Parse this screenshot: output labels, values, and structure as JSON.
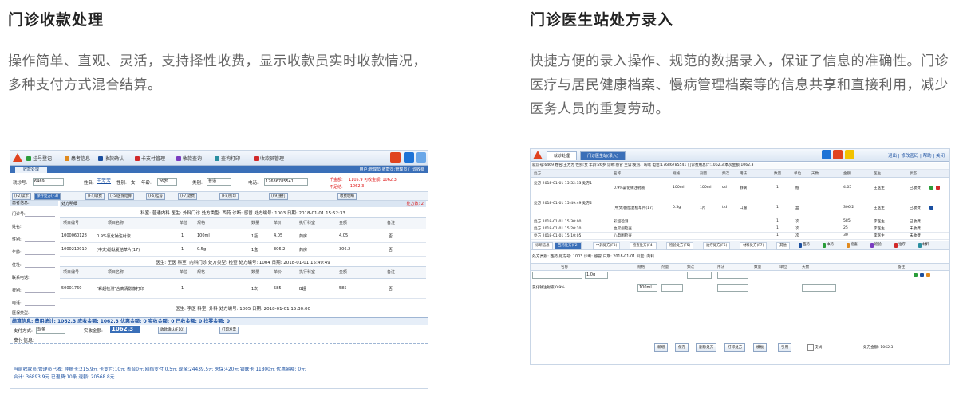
{
  "left": {
    "title": "门诊收款处理",
    "desc": "操作简单、直观、灵活，支持择性收费，显示收款员实时收款情况，多种支付方式混合结算。",
    "shot": {
      "toolbar": [
        "挂号登记",
        "患者信息",
        "收款确认",
        "卡支付管理",
        "收款查询",
        "查询打印",
        "收款员管理"
      ],
      "tab": "收款处理",
      "user_info": "用户:管理员 收款员:管理员 门诊收费",
      "form": {
        "card_label": "就诊号:",
        "card_value": "6469",
        "name_label": "姓名:",
        "name_value": "王芳芳",
        "sex_label": "性别:",
        "sex_value": "女",
        "age_label": "年龄:",
        "age_value": "26岁",
        "type_label": "类别:",
        "type_value": "普通",
        "phone_label": "电话:",
        "phone_value": "17686785541",
        "pay_label": "不足结:",
        "pay_value": "-1062.3",
        "due_label": "千金额:",
        "due_value": "1105.9 可收金额: 1062.3"
      },
      "buttons": [
        "(F2)读卡",
        "保存处方(F3)",
        "(F4)收费",
        "(F5)医保结算",
        "(F6)挂号",
        "(F7)退费",
        "(F8)打印",
        "(F9)重打",
        "收费明细"
      ],
      "side_head": "患者信息:",
      "side_rows": [
        "门诊号:",
        "姓名:",
        "性别:",
        "年龄:",
        "住址:",
        "联系电话:",
        "费别:",
        "电话:",
        "医保类型:"
      ],
      "main_head": "处方明细",
      "rx_total": "处方数: 2",
      "rx1_info": "科室: 普通内科 医生: 外科门诊 处方类型: 西药 诊断: 感冒 处方编号: 1003 日期: 2018-01-01 15:52:33",
      "grid_cols": [
        "项目编号",
        "项目名称",
        "单位",
        "规格",
        "数量",
        "单价",
        "执行科室",
        "金额",
        "备注"
      ],
      "rows1": [
        {
          "code": "1000060128",
          "name": "0.9%氯化钠注射液",
          "unit": "1",
          "spec": "100ml",
          "qty": "1瓶",
          "price": "4.05",
          "dept": "药房",
          "amt": "4.05",
          "note": "否"
        },
        {
          "code": "1000210010",
          "name": "(中文)酚酞夏枯草片(17)",
          "unit": "1",
          "spec": "0.5g",
          "qty": "1盒",
          "price": "306.2",
          "dept": "药房",
          "amt": "306.2",
          "note": "否"
        }
      ],
      "rx2_info": "医生: 王医 科室: 内科门诊 处方类型: 检查 处方编号: 1004 日期: 2018-01-01 15:49:49",
      "rows2": [
        {
          "code": "50001760",
          "name": "\"彩超检测\"含高清影像打印",
          "unit": "1",
          "spec": "",
          "qty": "1次",
          "price": "585",
          "dept": "B超",
          "amt": "585",
          "note": "否"
        }
      ],
      "rx3_info": "医生: 李医 科室: 外科 处方编号: 1005 日期: 2018-01-01 15:30:00",
      "summary": "结算信息: 费用统计: 1062.3 应收金额: 1062.3 优惠金额: 0 实收金额: 0 已收金额: 0 找零金额: 0",
      "pay_way_label": "支付方式:",
      "pay_way_value": "现金",
      "pay_recv_label": "实收金额:",
      "pay_recv_value": "1062.3",
      "pay_btns": [
        "收款确认(F10)",
        "打印发票"
      ],
      "pay_detail": "支付信息:",
      "footer1": "当前收款员:管理员已收: 挂账卡:215.9元 卡支付:10元 表合0元 网络支付:0.5元 现金:24439.5元 医保:420元 银联卡:11800元 优惠金额: 0元",
      "footer2": "合计: 36893.9元 已退费:10条 退额: 20568.8元"
    }
  },
  "right": {
    "title": "门诊医生站处方录入",
    "desc": "快捷方便的录入操作、规范的数据录入，保证了信息的准确性。门诊医疗与居民健康档案、慢病管理档案等的信息共享和直接利用，减少医务人员的重复劳动。",
    "shot": {
      "tabs": [
        "就诊处理",
        "门诊医生站(录入)"
      ],
      "links": "退出 | 修改密码 | 帮助 | 关闭",
      "info": "就诊号:6469 姓名:王芳芳 性别:女 年龄:26岁 诊断:感冒 主诉:发热、咳嗽 电话:17686785541 门诊费用总计:1062.3 本次金额:1062.3",
      "cols": [
        "处方",
        "名称",
        "规格",
        "剂量",
        "频次",
        "用法",
        "数量",
        "单位",
        "天数",
        "金额",
        "医生",
        "状态"
      ],
      "rows": [
        {
          "rx": "处方 2018-01-01 15:52:33 处方1",
          "name": "0.9%氯化钠注射液",
          "spec": "100ml",
          "dose": "100ml",
          "freq": "qd",
          "use": "静滴",
          "qty": "1",
          "unit": "瓶",
          "amt": "4.05",
          "doc": "王医生",
          "status": "已收费"
        },
        {
          "rx": "处方 2018-01-01 15:49:49 处方2",
          "name": "(中文)酚酞夏枯草片(17)",
          "spec": "0.5g",
          "dose": "1片",
          "freq": "tid",
          "use": "口服",
          "qty": "1",
          "unit": "盒",
          "amt": "306.2",
          "doc": "王医生",
          "status": "已收费"
        },
        {
          "rx": "处方 2018-01-01 15:30:00",
          "name": "彩超检测",
          "spec": "",
          "dose": "",
          "freq": "",
          "use": "",
          "qty": "1",
          "unit": "次",
          "amt": "585",
          "doc": "李医生",
          "status": "已收费"
        },
        {
          "rx": "处方 2018-01-01 15:20:10",
          "name": "血常规检查",
          "spec": "",
          "dose": "",
          "freq": "",
          "use": "",
          "qty": "1",
          "unit": "次",
          "amt": "25",
          "doc": "李医生",
          "status": "未收费"
        },
        {
          "rx": "处方 2018-01-01 15:10:05",
          "name": "心电图检查",
          "spec": "",
          "dose": "",
          "freq": "",
          "use": "",
          "qty": "1",
          "unit": "次",
          "amt": "30",
          "doc": "李医生",
          "status": "未收费"
        }
      ],
      "subtabs": [
        "诊断信息",
        "西药处方(F2)",
        "中药处方(F3)",
        "检查处方(F4)",
        "检验处方(F5)",
        "治疗处方(F6)",
        "材料处方(F7)",
        "其他"
      ],
      "chips": [
        {
          "label": "西药",
          "color": "#1a4fa0"
        },
        {
          "label": "中药",
          "color": "#2a9d3a"
        },
        {
          "label": "检查",
          "color": "#e08a1e"
        },
        {
          "label": "检验",
          "color": "#7a3cc0"
        },
        {
          "label": "治疗",
          "color": "#d12a2a"
        },
        {
          "label": "材料",
          "color": "#2a8fa0"
        }
      ],
      "edit_line1": "处方类别: 西药 处方号: 1003 诊断: 感冒 日期: 2018-01-01 科室: 内科",
      "edit_cols": [
        "名称",
        "规格",
        "剂量",
        "频次",
        "用法",
        "数量",
        "单位",
        "天数",
        "备注"
      ],
      "edit_row1": "1.0g",
      "edit_row2": "氯化钠注射液 0.9%",
      "edit_row2_dose": "100ml",
      "buttons": [
        "新增",
        "保存",
        "删除处方",
        "打印处方",
        "模板",
        "引用"
      ],
      "check_label": "皮试",
      "total_label": "处方金额: 1062.3"
    }
  }
}
